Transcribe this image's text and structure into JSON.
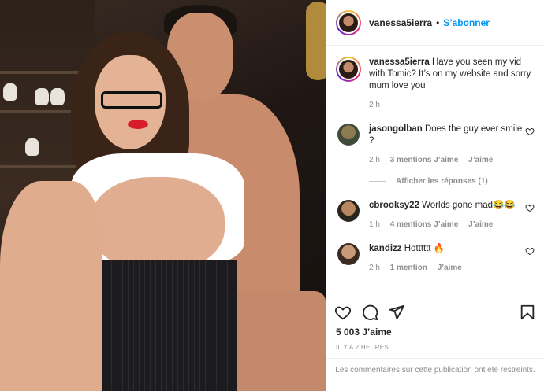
{
  "post": {
    "author": "vanessa5ierra",
    "separator": "•",
    "follow_label": "S’abonner"
  },
  "caption": {
    "username": "vanessa5ierra",
    "text": "Have you seen my vid with Tomic? It’s on my website and sorry mum love you",
    "time": "2 h"
  },
  "comments": [
    {
      "username": "jasongolban",
      "text": "Does the guy ever smile ?",
      "time": "2 h",
      "likes": "3 mentions J’aime",
      "reply": "J’aime",
      "view_replies": "Afficher les réponses (1)"
    },
    {
      "username": "cbrooksy22",
      "text": "Worlds gone mad😂😂",
      "time": "1 h",
      "likes": "4 mentions J’aime",
      "reply": "J’aime"
    },
    {
      "username": "kandizz",
      "text": "Hotttttt 🔥",
      "time": "2 h",
      "likes": "1 mention",
      "reply": "J’aime"
    }
  ],
  "stats": {
    "likes": "5 003 J’aime",
    "posted": "IL Y A 2 HEURES"
  },
  "restricted_notice": "Les commentaires sur cette publication ont été restreints.",
  "icons": [
    "heart-icon",
    "comment-icon",
    "share-icon",
    "bookmark-icon"
  ],
  "colors": {
    "accent": "#0095f6",
    "muted": "#8e8e8e",
    "text": "#262626"
  }
}
